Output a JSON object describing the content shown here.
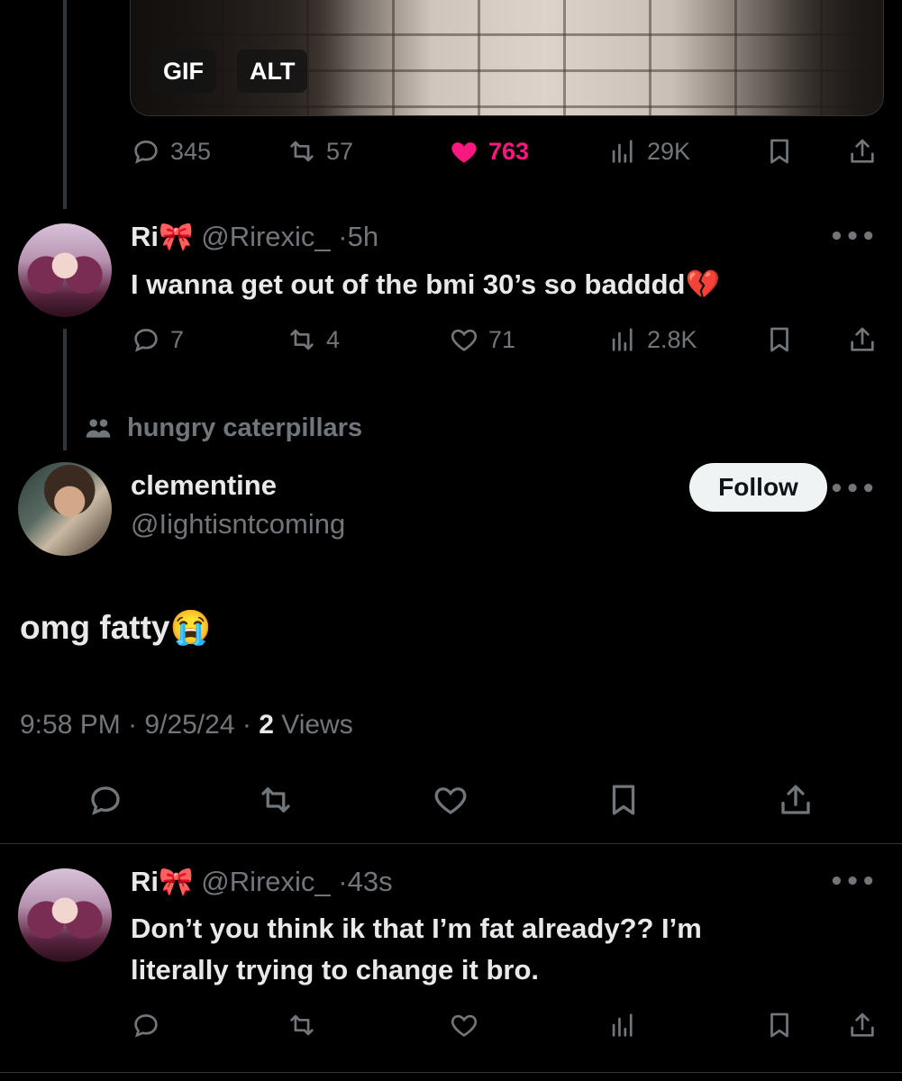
{
  "media": {
    "gif_label": "GIF",
    "alt_label": "ALT"
  },
  "first_actions": {
    "replies": "345",
    "reposts": "57",
    "likes": "763",
    "views": "29K"
  },
  "tweet1": {
    "name": "Ri",
    "name_emoji": "🎀",
    "handle": "@Rirexic_",
    "separator": "·",
    "time": "5h",
    "text": "I wanna get out of the bmi 30’s so badddd",
    "text_emoji": "💔",
    "replies": "7",
    "reposts": "4",
    "likes": "71",
    "views": "2.8K"
  },
  "community": {
    "label": "hungry caterpillars"
  },
  "main": {
    "name": "clementine",
    "handle": "@Iightisntcoming",
    "follow_label": "Follow",
    "text": "omg fatty",
    "text_emoji": "😭",
    "time": "9:58 PM",
    "date": "9/25/24",
    "views_count": "2",
    "views_label": "Views",
    "separator": "·"
  },
  "tweet2": {
    "name": "Ri",
    "name_emoji": "🎀",
    "handle": "@Rirexic_",
    "separator": "·",
    "time": "43s",
    "text_line1": "Don’t you think ik that I’m fat already?? I’m",
    "text_line2": "literally trying to change it bro."
  },
  "more_label": "•••",
  "colors": {
    "accent_like": "#f91880",
    "muted": "#71767b",
    "text": "#e7e9ea",
    "background": "#000000"
  }
}
